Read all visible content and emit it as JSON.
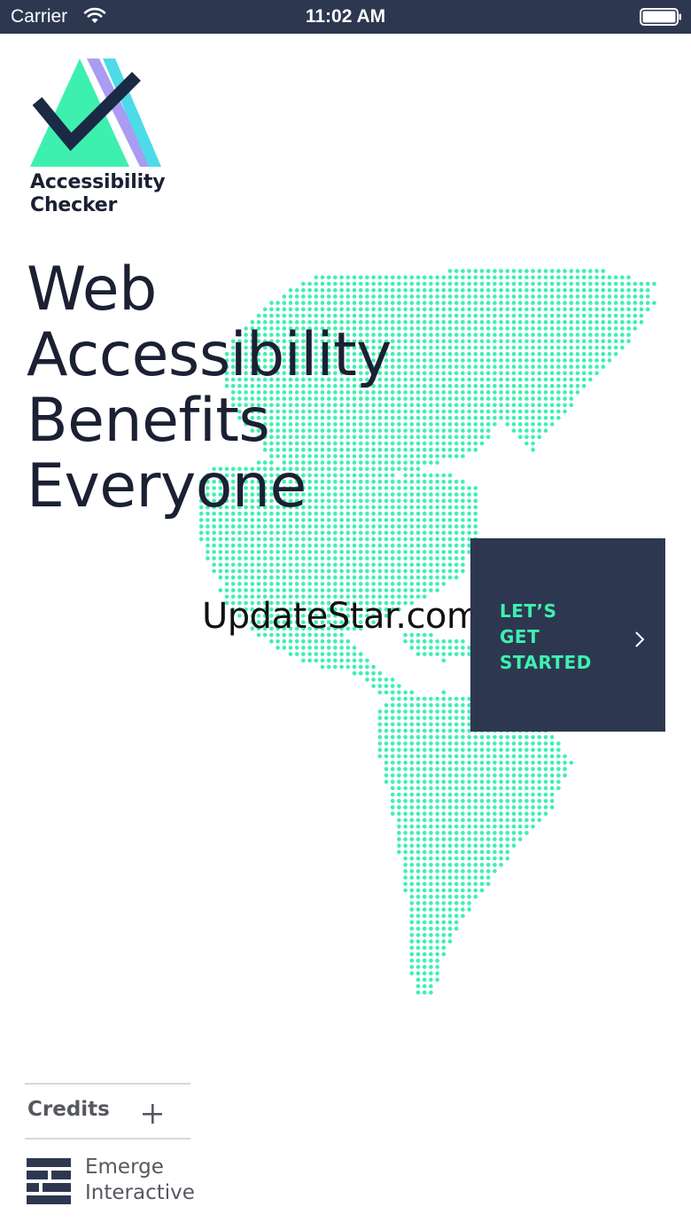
{
  "status_bar": {
    "carrier": "Carrier",
    "time": "11:02 AM",
    "wifi_icon": "wifi-icon",
    "battery_icon": "battery-icon"
  },
  "logo": {
    "line1": "Accessibility",
    "line2": "Checker",
    "colors": {
      "triangle": "#3ef0b0",
      "stripe_purple": "#a99cf2",
      "stripe_cyan": "#4ddbe9",
      "check": "#1b2a44"
    }
  },
  "headline": {
    "line1": "Web",
    "line2": "Accessibility",
    "line3": "Benefits",
    "line4": "Everyone"
  },
  "watermark": "UpdateStar.com",
  "cta": {
    "line1": "LET’S",
    "line2": "GET",
    "line3": "STARTED",
    "icon": "chevron-right-icon"
  },
  "credits": {
    "label": "Credits",
    "icon": "plus-icon"
  },
  "footer": {
    "company_line1": "Emerge",
    "company_line2": "Interactive"
  },
  "colors": {
    "navy": "#2d3850",
    "accent_green": "#3ef0b0",
    "headline_text": "#1b2033",
    "map_dots": "#3ef0b0"
  }
}
